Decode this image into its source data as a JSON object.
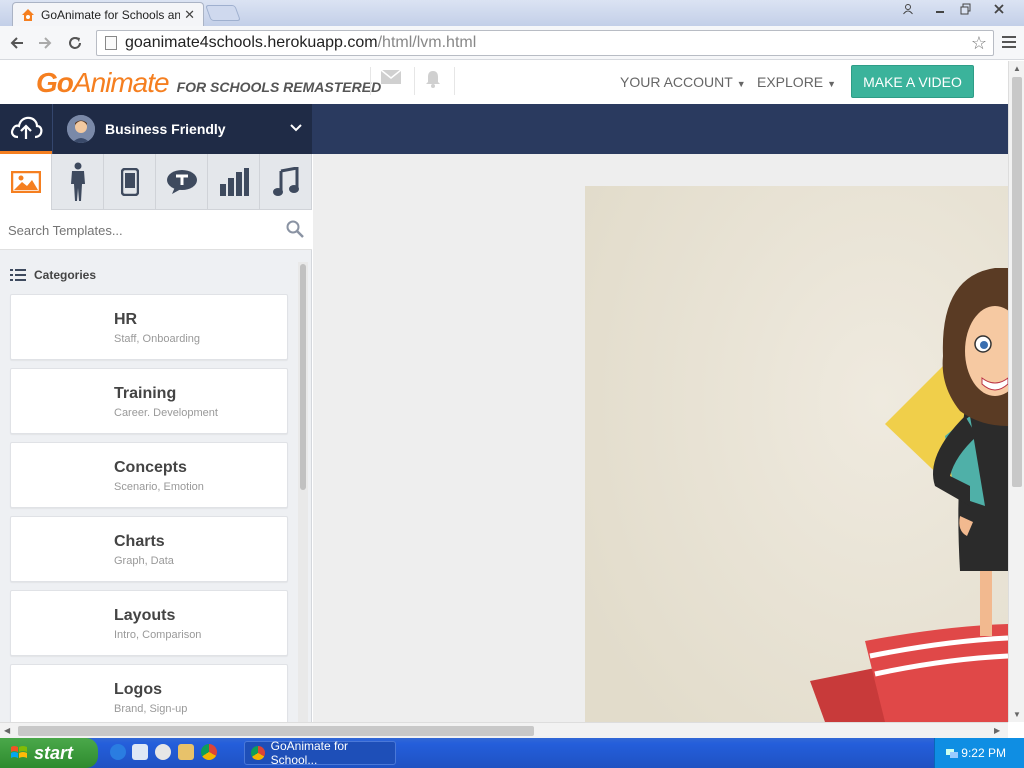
{
  "browser": {
    "tab_title": "GoAnimate for Schools and E",
    "tab_close": "✕",
    "url_host": "goanimate4schools.herokuapp.com",
    "url_path": "/html/lvm.html",
    "window_buttons": [
      "person-icon",
      "minimize-icon",
      "restore-icon",
      "close-icon"
    ]
  },
  "header": {
    "logo_go": "Go",
    "logo_animate": "Animate",
    "logo_sub": "FOR SCHOOLS REMASTERED",
    "account_label": "YOUR ACCOUNT",
    "explore_label": "EXPLORE",
    "make_video_label": "MAKE A VIDEO",
    "accent_color": "#f57f20",
    "button_color": "#3bb39b"
  },
  "studio": {
    "theme_name": "Business Friendly",
    "bar_color": "#2a3a5f"
  },
  "panel": {
    "tabs": [
      "image-icon",
      "character-icon",
      "phone-icon",
      "speech-bubble-icon",
      "chart-icon",
      "music-icon"
    ],
    "search_placeholder": "Search Templates...",
    "categories_label": "Categories",
    "categories": [
      {
        "name": "HR",
        "desc": "Staff, Onboarding"
      },
      {
        "name": "Training",
        "desc": "Career. Development"
      },
      {
        "name": "Concepts",
        "desc": "Scenario, Emotion"
      },
      {
        "name": "Charts",
        "desc": "Graph, Data"
      },
      {
        "name": "Layouts",
        "desc": "Intro, Comparison"
      },
      {
        "name": "Logos",
        "desc": "Brand, Sign-up"
      }
    ]
  },
  "taskbar": {
    "start_label": "start",
    "task_label": "GoAnimate for School...",
    "clock": "9:22 PM"
  }
}
